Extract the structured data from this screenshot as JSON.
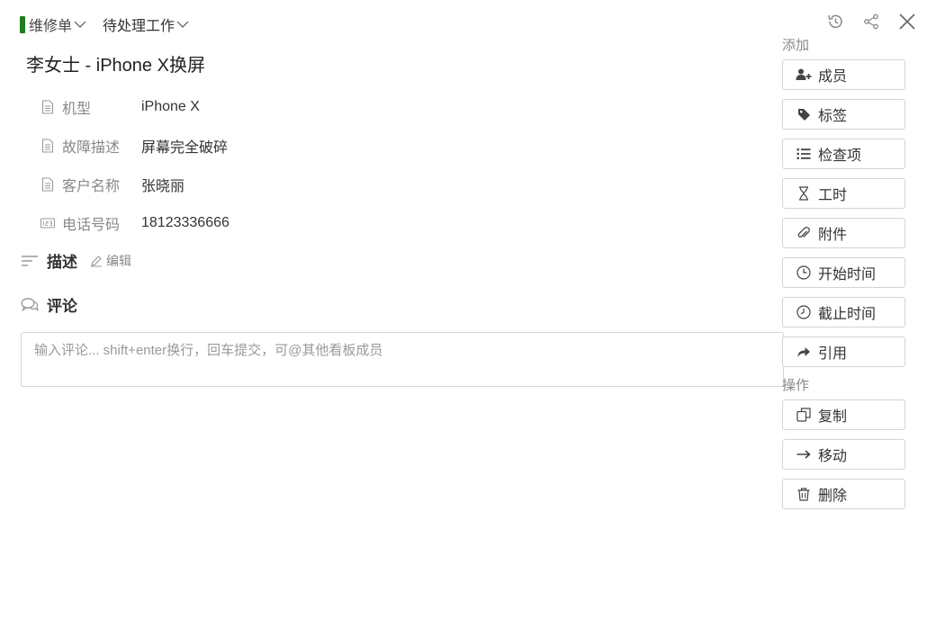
{
  "breadcrumb": {
    "board": "维修单",
    "list": "待处理工作"
  },
  "card": {
    "title": "李女士 - iPhone X换屏"
  },
  "fields": [
    {
      "name": "机型",
      "value": "iPhone X",
      "icon": "document-icon"
    },
    {
      "name": "故障描述",
      "value": "屏幕完全破碎",
      "icon": "document-icon"
    },
    {
      "name": "客户名称",
      "value": "张晓丽",
      "icon": "document-icon"
    },
    {
      "name": "电话号码",
      "value": "18123336666",
      "icon": "number-icon"
    }
  ],
  "description": {
    "title": "描述",
    "edit_label": "编辑"
  },
  "comments": {
    "title": "评论",
    "placeholder": "输入评论... shift+enter换行，回车提交，可@其他看板成员"
  },
  "sidebar": {
    "add_label": "添加",
    "add_buttons": [
      "成员",
      "标签",
      "检查项",
      "工时",
      "附件",
      "开始时间",
      "截止时间",
      "引用"
    ],
    "actions_label": "操作",
    "action_buttons": [
      "复制",
      "移动",
      "删除"
    ]
  },
  "colors": {
    "board_mark": "#1e7d1e",
    "border": "#d4d4d4",
    "muted_text": "#888888"
  }
}
